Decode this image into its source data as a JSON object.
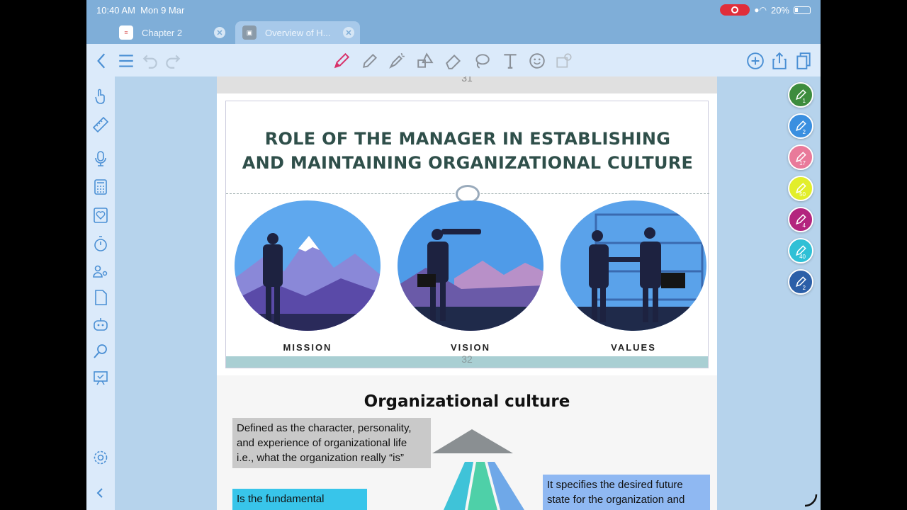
{
  "status": {
    "time": "10:40 AM",
    "date": "Mon 9 Mar",
    "battery": "20%"
  },
  "tabs": [
    {
      "label": "Chapter 2",
      "active": false
    },
    {
      "label": "Overview of H...",
      "active": true
    }
  ],
  "pages": {
    "top_number": "31",
    "middle_number": "32"
  },
  "slide": {
    "title_line1": "ROLE OF THE MANAGER IN ESTABLISHING",
    "title_line2": "AND MAINTAINING ORGANIZATIONAL CULTURE",
    "captions": [
      "MISSION",
      "VISION",
      "VALUES"
    ]
  },
  "lower": {
    "title": "Organizational culture",
    "box_gray": "Defined as the character, personality, and experience of organizational life i.e., what the organization really “is”",
    "box_cyan": "Is the fundamental",
    "box_blue": "It specifies the desired future state for the organization and"
  },
  "pens": [
    {
      "color": "#3d8c3d",
      "size": "1"
    },
    {
      "color": "#3a8fe0",
      "size": "2"
    },
    {
      "color": "#e97a9a",
      "size": "17"
    },
    {
      "color": "#e2ee2a",
      "size": "50"
    },
    {
      "color": "#b3247e",
      "size": "4"
    },
    {
      "color": "#2fc0d6",
      "size": "40"
    },
    {
      "color": "#2b5fa8",
      "size": "2"
    }
  ],
  "colors": {
    "accent": "#4a8fd4",
    "active_tool": "#d8336b"
  }
}
